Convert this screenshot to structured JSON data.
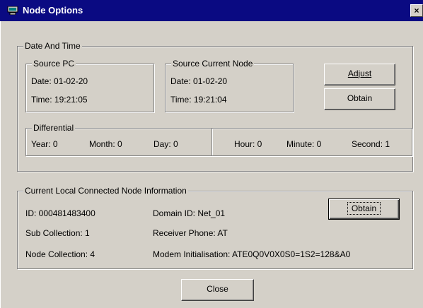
{
  "window": {
    "title": "Node Options",
    "close_glyph": "×"
  },
  "date_time": {
    "legend": "Date And Time",
    "source_pc": {
      "legend": "Source PC",
      "date": "Date: 01-02-20",
      "time": "Time: 19:21:05"
    },
    "source_node": {
      "legend": "Source Current Node",
      "date": "Date: 01-02-20",
      "time": "Time: 19:21:04"
    },
    "adjust_label": "Adjust",
    "obtain_label": "Obtain",
    "differential": {
      "legend": "Differential",
      "year": "Year: 0",
      "month": "Month: 0",
      "day": "Day: 0",
      "hour": "Hour: 0",
      "minute": "Minute: 0",
      "second": "Second: 1"
    }
  },
  "node_info": {
    "legend": "Current Local Connected Node Information",
    "id": "ID: 000481483400",
    "sub_collection": "Sub Collection: 1",
    "node_collection": "Node Collection: 4",
    "domain_id": "Domain ID: Net_01",
    "receiver_phone": "Receiver Phone: AT",
    "modem_init": "Modem Initialisation: ATE0Q0V0X0S0=1S2=128&A0",
    "obtain_label": "Obtain"
  },
  "close_label": "Close",
  "icons": {
    "title": "computer-icon",
    "close": "close-icon"
  }
}
